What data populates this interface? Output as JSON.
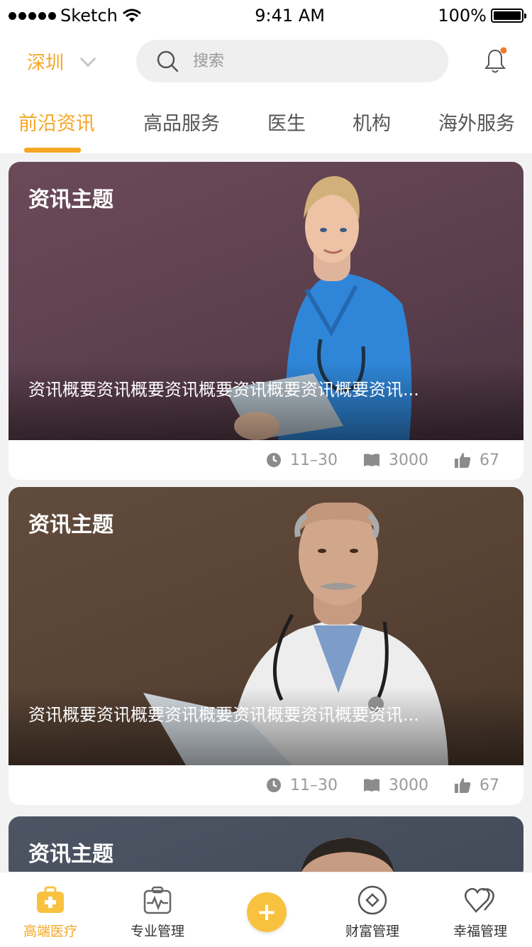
{
  "status_bar": {
    "carrier": "Sketch",
    "time": "9:41 AM",
    "battery": "100%"
  },
  "header": {
    "city": "深圳",
    "search": {
      "placeholder": "搜索"
    },
    "tabs": [
      {
        "label": "前沿资讯",
        "active": true
      },
      {
        "label": "高品服务"
      },
      {
        "label": "医生"
      },
      {
        "label": "机构"
      },
      {
        "label": "海外服务"
      }
    ]
  },
  "feed": [
    {
      "title": "资讯主题",
      "summary": "资讯概要资讯概要资讯概要资讯概要资讯概要资讯...",
      "date": "11–30",
      "reads": "3000",
      "likes": "67",
      "bg": "#5e4350"
    },
    {
      "title": "资讯主题",
      "summary": "资讯概要资讯概要资讯概要资讯概要资讯概要资讯...",
      "date": "11–30",
      "reads": "3000",
      "likes": "67",
      "bg": "#5a4637"
    },
    {
      "title": "资讯主题",
      "bg": "#454d5c"
    }
  ],
  "tab_bar": {
    "items": [
      {
        "label": "高端医疗",
        "icon": "medical-kit-icon",
        "active": true
      },
      {
        "label": "专业管理",
        "icon": "heart-monitor-icon"
      },
      {
        "label": "",
        "icon": "plus-icon"
      },
      {
        "label": "财富管理",
        "icon": "diamond-icon"
      },
      {
        "label": "幸福管理",
        "icon": "hearts-icon"
      }
    ]
  },
  "colors": {
    "accent": "#f5a623",
    "tab_plus": "#f8c240"
  }
}
